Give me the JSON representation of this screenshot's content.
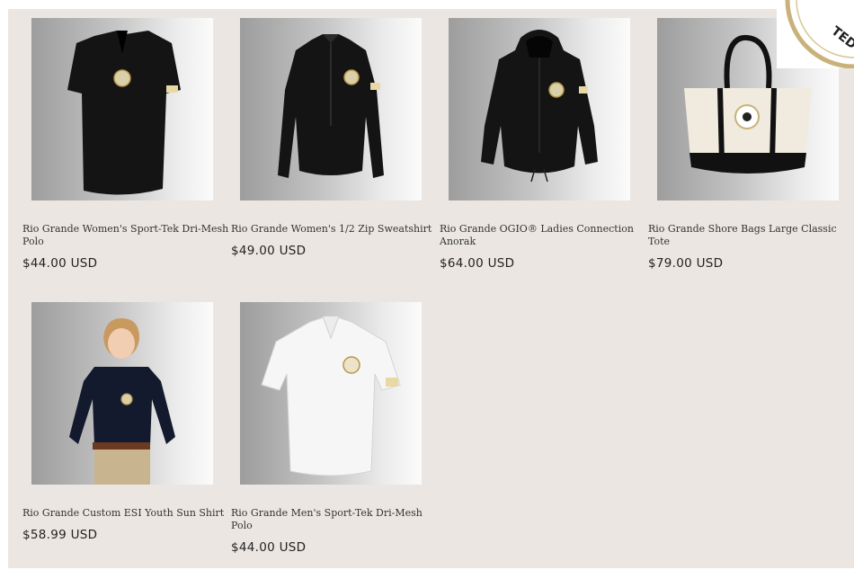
{
  "products": [
    {
      "title": "Rio Grande Women's Sport-Tek Dri-Mesh Polo",
      "price": "$44.00 USD",
      "image_icon": "black-womens-polo-image"
    },
    {
      "title": "Rio Grande Women's 1/2 Zip Sweatshirt",
      "price": "$49.00 USD",
      "image_icon": "black-zip-sweatshirt-image"
    },
    {
      "title": "Rio Grande OGIO® Ladies Connection Anorak",
      "price": "$64.00 USD",
      "image_icon": "black-anorak-image"
    },
    {
      "title": "Rio Grande Shore Bags Large Classic Tote",
      "price": "$79.00 USD",
      "image_icon": "canvas-tote-image"
    },
    {
      "title": "Rio Grande Custom ESI Youth Sun Shirt",
      "price": "$58.99 USD",
      "image_icon": "youth-sun-shirt-image"
    },
    {
      "title": "Rio Grande Men's Sport-Tek Dri-Mesh Polo",
      "price": "$44.00 USD",
      "image_icon": "white-mens-polo-image"
    }
  ],
  "badge": {
    "text": "TED S",
    "icon": "seal-badge-icon"
  },
  "colors": {
    "background": "#ebe6e2",
    "text": "#333333",
    "garment_black": "#141414",
    "gold": "#b8954a"
  }
}
